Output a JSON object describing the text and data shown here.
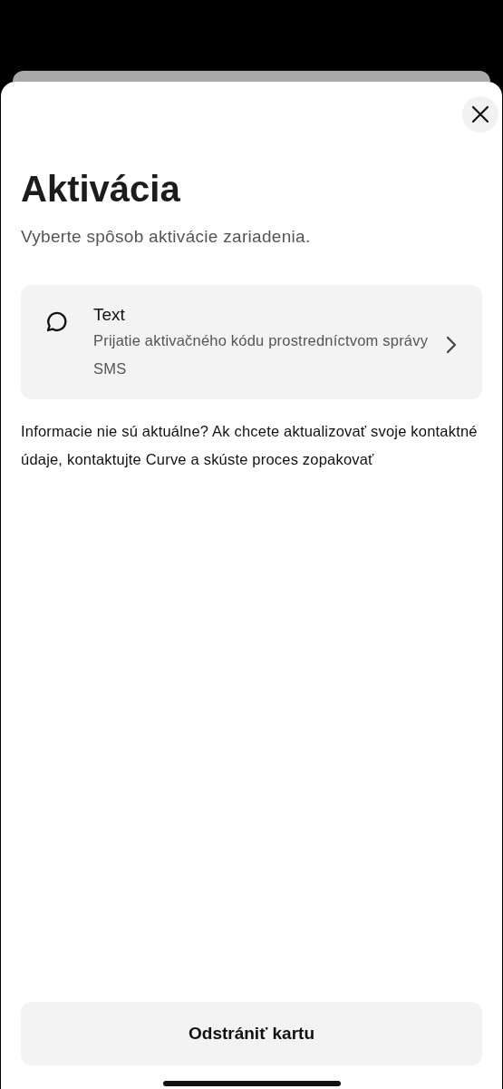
{
  "sheet": {
    "title": "Aktivácia",
    "subtitle": "Vyberte spôsob aktivácie zariadenia."
  },
  "options": [
    {
      "kind": "sms",
      "title": "Text",
      "description": "Prijatie aktivačného kódu prostredníctvom správy SMS"
    }
  ],
  "info": "Informacie nie sú aktuálne? Ak chcete aktualizovať svoje kontaktné údaje, kontaktujte Curve a skúste proces zopakovať",
  "footer_button": "Odstrániť kartu"
}
